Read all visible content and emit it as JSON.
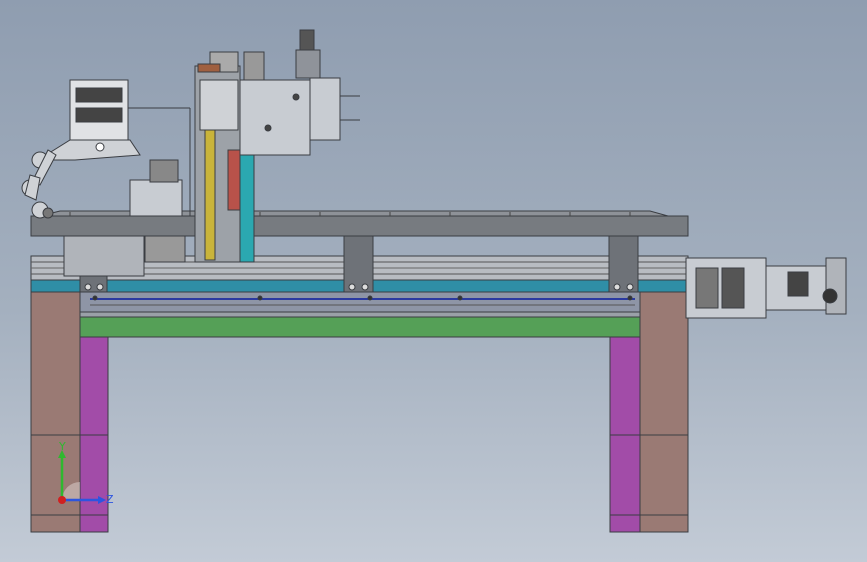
{
  "viewport": {
    "background_top": "#8f9db0",
    "background_bottom": "#c3cbd6"
  },
  "triad": {
    "y_label": "Y",
    "z_label": "Z",
    "y_color": "#2fb82f",
    "z_color": "#2d55e0",
    "origin_color": "#d02020"
  },
  "colors": {
    "leg_outer": "#9a7a74",
    "leg_inner": "#a24ca8",
    "green_band": "#55a057",
    "teal_band": "#2f8ea6",
    "top_plate": "#777b80",
    "rail": "#b8bcc2",
    "column_yellow": "#c9b43a",
    "column_red": "#b8524a",
    "column_teal": "#2ba8b0",
    "motor_body": "#c8ccd2",
    "dark_edge": "#3a3d42"
  }
}
